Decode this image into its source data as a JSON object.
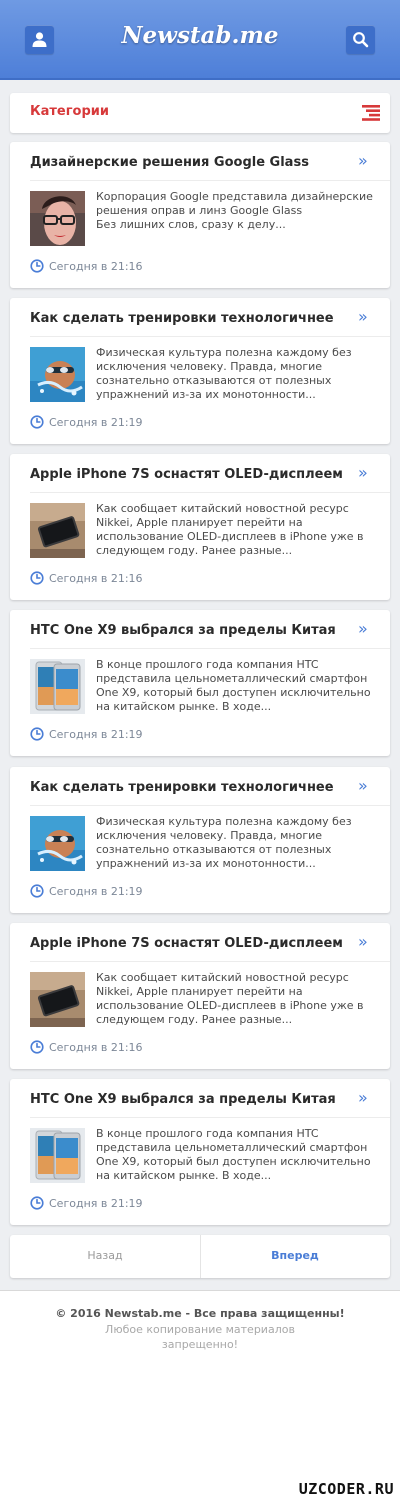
{
  "header": {
    "logo": "Newstab.me",
    "user_icon": "user-icon",
    "search_icon": "search-icon"
  },
  "categories": {
    "label": "Категории",
    "menu_icon": "menu-icon",
    "accent": "#d7393a"
  },
  "cards": [
    {
      "title": "Дизайнерские решения Google Glass",
      "text": "Корпорация Google представила дизайнерские решения оправ и линз Google Glass\nБез лишних слов, сразу к делу...",
      "time": "Сегодня в 21:16",
      "thumb": "glasses-woman"
    },
    {
      "title": "Как сделать тренировки технологичнее",
      "text": "Физическая культура полезна каждому без исключения человеку. Правда, многие сознательно отказываются от полезных упражнений из-за их монотонности...",
      "time": "Сегодня в 21:19",
      "thumb": "swimmer"
    },
    {
      "title": "Apple iPhone 7S оснастят OLED-дисплеем",
      "text": "Как сообщает китайский новостной ресурс Nikkei, Apple планирует перейти на использование OLED-дисплеев в iPhone уже в следующем году. Ранее разные...",
      "time": "Сегодня в 21:16",
      "thumb": "iphone"
    },
    {
      "title": "HTC One X9 выбрался за пределы Китая",
      "text": "В конце прошлого года компания HTC представила цельнометаллический смартфон One X9, который был доступен исключительно на китайском рынке. В ходе...",
      "time": "Сегодня в 21:19",
      "thumb": "htc"
    },
    {
      "title": "Как сделать тренировки технологичнее",
      "text": "Физическая культура полезна каждому без исключения человеку. Правда, многие сознательно отказываются от полезных упражнений из-за их монотонности...",
      "time": "Сегодня в 21:19",
      "thumb": "swimmer"
    },
    {
      "title": "Apple iPhone 7S оснастят OLED-дисплеем",
      "text": "Как сообщает китайский новостной ресурс Nikkei, Apple планирует перейти на использование OLED-дисплеев в iPhone уже в следующем году. Ранее разные...",
      "time": "Сегодня в 21:16",
      "thumb": "iphone"
    },
    {
      "title": "HTC One X9 выбрался за пределы Китая",
      "text": "В конце прошлого года компания HTC представила цельнометаллический смартфон One X9, который был доступен исключительно на китайском рынке. В ходе...",
      "time": "Сегодня в 21:19",
      "thumb": "htc"
    }
  ],
  "pager": {
    "prev": "Назад",
    "next": "Вперед"
  },
  "footer": {
    "copyright": "© 2016 Newstab.me - Все права защищенны!",
    "note_line1": "Любое копирование материалов",
    "note_line2": "запрещенно!"
  },
  "watermark": "UZCODER.RU",
  "colors": {
    "brand": "#4e7fd8",
    "accent": "#d7393a",
    "link": "#4a7dd6"
  }
}
